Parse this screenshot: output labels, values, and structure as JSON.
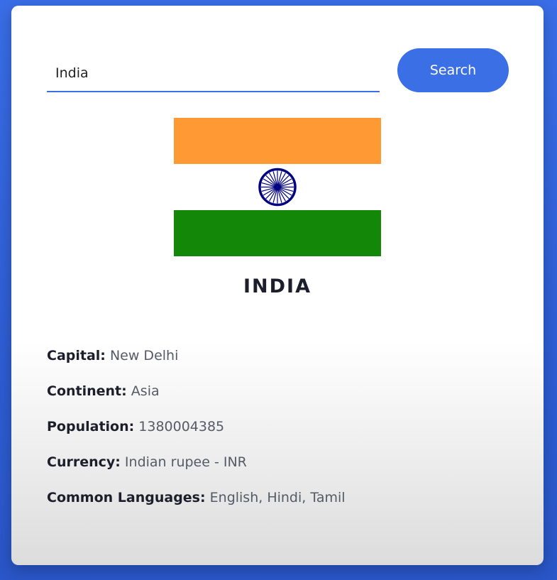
{
  "search": {
    "value": "India",
    "button_label": "Search"
  },
  "flag": {
    "description_icon": "india-flag-icon",
    "colors": {
      "saffron": "#FF9933",
      "white": "#FFFFFF",
      "green": "#138808",
      "chakra": "#000080"
    }
  },
  "country": {
    "name": "INDIA"
  },
  "details": [
    {
      "label": "Capital:",
      "value": "New Delhi"
    },
    {
      "label": "Continent:",
      "value": "Asia"
    },
    {
      "label": "Population:",
      "value": "1380004385"
    },
    {
      "label": "Currency:",
      "value": "Indian rupee - INR"
    },
    {
      "label": "Common Languages:",
      "value": "English, Hindi, Tamil"
    }
  ],
  "theme": {
    "accent": "#3B6FE6"
  }
}
